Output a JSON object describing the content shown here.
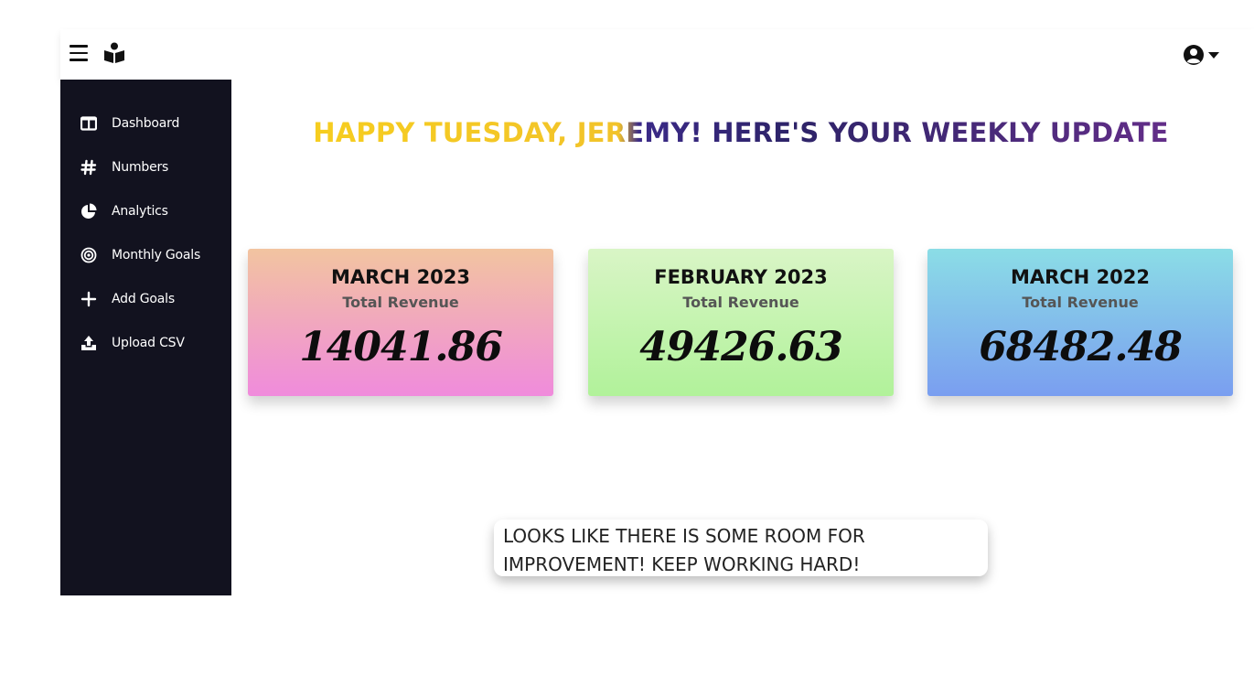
{
  "topbar": {
    "menu_icon": "hamburger-icon",
    "logo_icon": "reading-person-icon",
    "user_icon": "user-circle-icon",
    "user_dropdown_icon": "caret-down-icon"
  },
  "sidebar": {
    "items": [
      {
        "label": "Dashboard",
        "icon": "columns-icon"
      },
      {
        "label": "Numbers",
        "icon": "hashtag-icon"
      },
      {
        "label": "Analytics",
        "icon": "pie-chart-icon"
      },
      {
        "label": "Monthly Goals",
        "icon": "target-icon"
      },
      {
        "label": "Add Goals",
        "icon": "plus-icon"
      },
      {
        "label": "Upload CSV",
        "icon": "upload-icon"
      }
    ]
  },
  "main": {
    "greeting": "HAPPY TUESDAY, JEREMY! HERE'S YOUR WEEKLY UPDATE",
    "cards": [
      {
        "title": "MARCH 2023",
        "subtitle": "Total Revenue",
        "value": "14041.86"
      },
      {
        "title": "FEBRUARY 2023",
        "subtitle": "Total Revenue",
        "value": "49426.63"
      },
      {
        "title": "MARCH 2022",
        "subtitle": "Total Revenue",
        "value": "68482.48"
      }
    ],
    "message": "LOOKS LIKE THERE IS SOME ROOM FOR IMPROVEMENT! KEEP WORKING HARD!"
  },
  "colors": {
    "sidebar_bg": "#12121f",
    "greeting_start": "#f7d01c",
    "greeting_end": "#6e2f8f"
  }
}
